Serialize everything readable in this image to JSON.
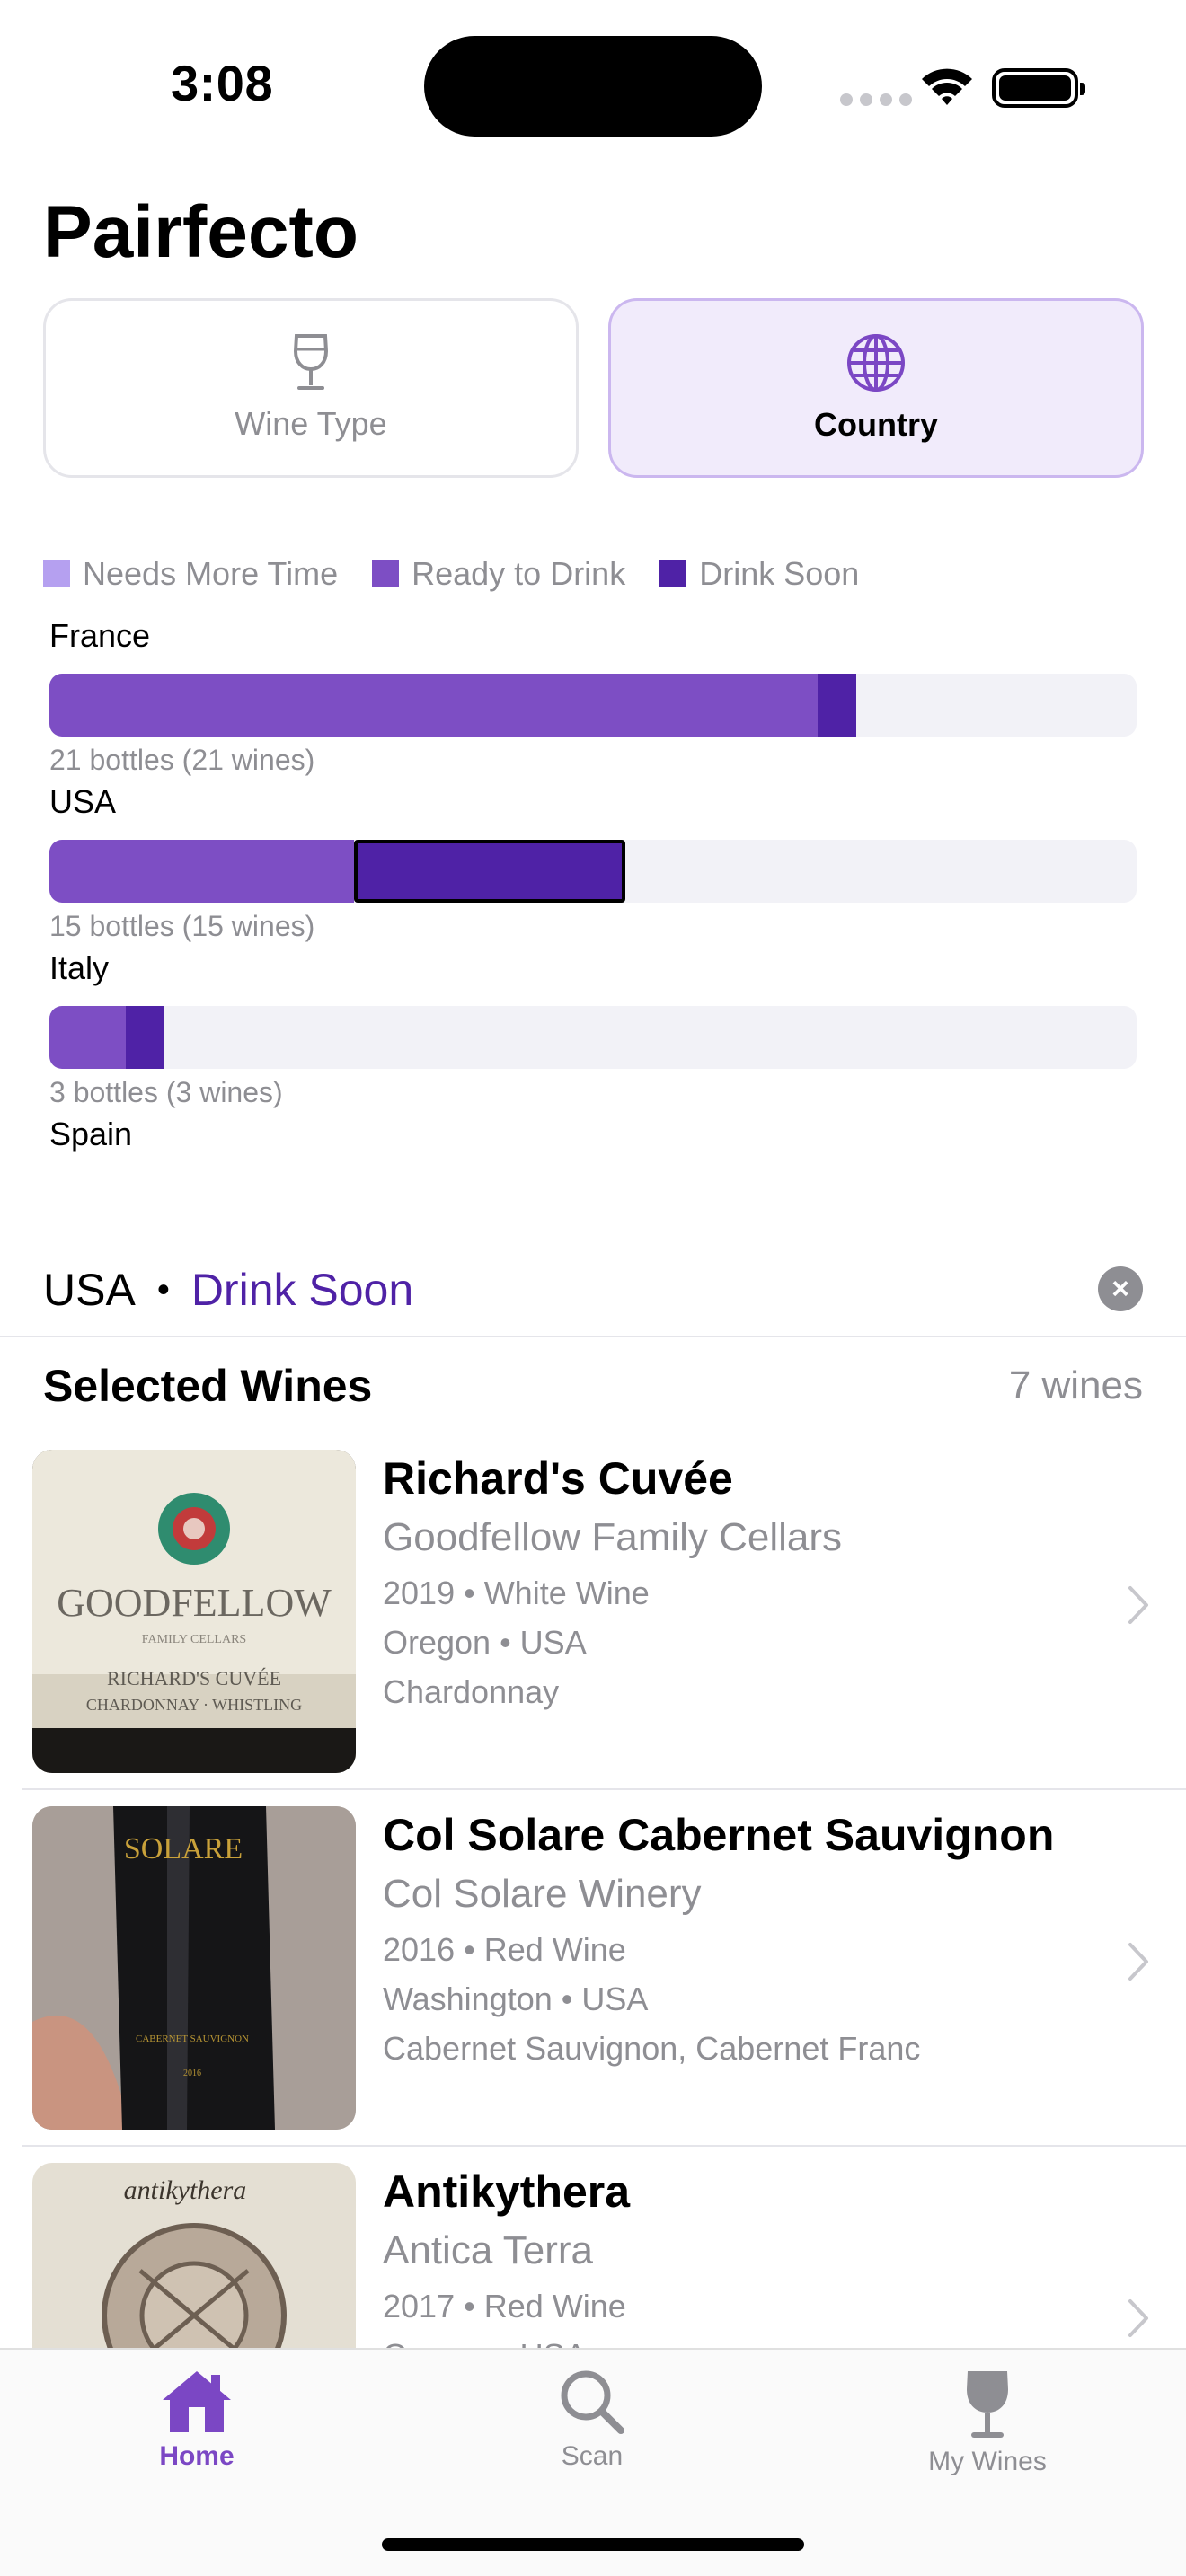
{
  "status": {
    "time": "3:08"
  },
  "app": {
    "title": "Pairfecto"
  },
  "segments": {
    "wine_type": "Wine Type",
    "country": "Country"
  },
  "colors": {
    "needs_more_time": "#b5a0f0",
    "ready_to_drink": "#7d4ec4",
    "drink_soon": "#4f22a6",
    "track": "#f2f2f7",
    "accent": "#7b47c4"
  },
  "legend": [
    {
      "label": "Needs More Time",
      "color": "#b5a0f0"
    },
    {
      "label": "Ready to Drink",
      "color": "#7d4ec4"
    },
    {
      "label": "Drink Soon",
      "color": "#4f22a6"
    }
  ],
  "countries": [
    {
      "name": "France",
      "caption": "21 bottles (21 wines)",
      "ready_to_drink": 0.707,
      "drink_soon": 0.035,
      "selected_drink_soon": false
    },
    {
      "name": "USA",
      "caption": "15 bottles (15 wines)",
      "ready_to_drink": 0.28,
      "drink_soon": 0.25,
      "selected_drink_soon": true
    },
    {
      "name": "Italy",
      "caption": "3 bottles (3 wines)",
      "ready_to_drink": 0.07,
      "drink_soon": 0.035,
      "selected_drink_soon": false
    },
    {
      "name": "Spain"
    }
  ],
  "filter": {
    "country": "USA",
    "separator": "•",
    "status": "Drink Soon"
  },
  "section": {
    "title": "Selected Wines",
    "count": "7 wines"
  },
  "wines": [
    {
      "name": "Richard's Cuvée",
      "producer": "Goodfellow Family Cellars",
      "line1": "2019 • White Wine",
      "line2": "Oregon • USA",
      "line3": "Chardonnay"
    },
    {
      "name": "Col Solare Cabernet Sauvignon",
      "producer": "Col Solare Winery",
      "line1": "2016 • Red Wine",
      "line2": "Washington • USA",
      "line3": "Cabernet Sauvignon, Cabernet Franc"
    },
    {
      "name": "Antikythera",
      "producer": "Antica Terra",
      "line1": "2017 • Red Wine",
      "line2": "Oregon • USA",
      "line3": ""
    }
  ],
  "tabs": [
    {
      "label": "Home",
      "icon": "house-icon",
      "active": true
    },
    {
      "label": "Scan",
      "icon": "magnifying-glass-icon",
      "active": false
    },
    {
      "label": "My Wines",
      "icon": "wine-glass-icon",
      "active": false
    }
  ]
}
